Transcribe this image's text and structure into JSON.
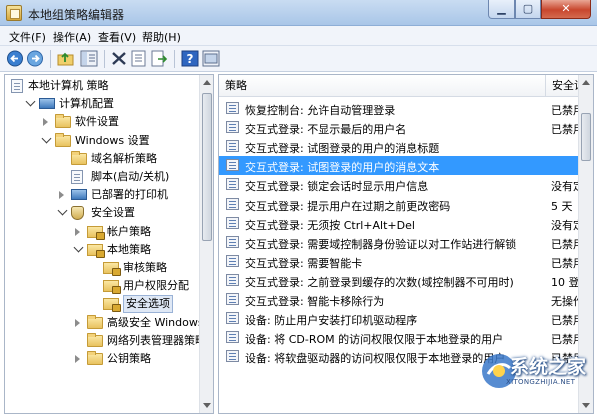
{
  "window": {
    "title": "本地组策略编辑器"
  },
  "menu": [
    "文件(F)",
    "操作(A)",
    "查看(V)",
    "帮助(H)"
  ],
  "toolbar": [
    "back-icon",
    "forward-icon",
    "up-folder-icon",
    "show-hide-tree-icon",
    "delete-icon",
    "properties-icon",
    "export-icon",
    "help-icon",
    "view-icon"
  ],
  "tree": [
    {
      "label": "本地计算机 策略",
      "depth": 0,
      "expander": "none",
      "icon": "doc"
    },
    {
      "label": "计算机配置",
      "depth": 1,
      "expander": "open",
      "icon": "comp"
    },
    {
      "label": "软件设置",
      "depth": 2,
      "expander": "closed",
      "icon": "folder"
    },
    {
      "label": "Windows 设置",
      "depth": 2,
      "expander": "open",
      "icon": "folder"
    },
    {
      "label": "域名解析策略",
      "depth": 3,
      "expander": "none",
      "icon": "folder"
    },
    {
      "label": "脚本(启动/关机)",
      "depth": 3,
      "expander": "none",
      "icon": "doc"
    },
    {
      "label": "已部署的打印机",
      "depth": 3,
      "expander": "closed",
      "icon": "comp"
    },
    {
      "label": "安全设置",
      "depth": 3,
      "expander": "open",
      "icon": "shield"
    },
    {
      "label": "帐户策略",
      "depth": 4,
      "expander": "closed",
      "icon": "lockf"
    },
    {
      "label": "本地策略",
      "depth": 4,
      "expander": "open",
      "icon": "lockf"
    },
    {
      "label": "审核策略",
      "depth": 5,
      "expander": "none",
      "icon": "lockf"
    },
    {
      "label": "用户权限分配",
      "depth": 5,
      "expander": "none",
      "icon": "lockf"
    },
    {
      "label": "安全选项",
      "depth": 5,
      "expander": "none",
      "icon": "lockf",
      "selected": true
    },
    {
      "label": "高级安全 Windows",
      "depth": 4,
      "expander": "closed",
      "icon": "folder"
    },
    {
      "label": "网络列表管理器策略",
      "depth": 4,
      "expander": "none",
      "icon": "folder"
    },
    {
      "label": "公钥策略",
      "depth": 4,
      "expander": "closed",
      "icon": "folder"
    }
  ],
  "list": {
    "headers": [
      "策略",
      "安全设"
    ],
    "rows": [
      {
        "policy": "恢复控制台: 允许自动管理登录",
        "setting": "已禁用"
      },
      {
        "policy": "交互式登录: 不显示最后的用户名",
        "setting": "已禁用"
      },
      {
        "policy": "交互式登录: 试图登录的用户的消息标题",
        "setting": ""
      },
      {
        "policy": "交互式登录: 试图登录的用户的消息文本",
        "setting": "",
        "selected": true
      },
      {
        "policy": "交互式登录: 锁定会话时显示用户信息",
        "setting": "没有定"
      },
      {
        "policy": "交互式登录: 提示用户在过期之前更改密码",
        "setting": "5 天"
      },
      {
        "policy": "交互式登录: 无须按 Ctrl+Alt+Del",
        "setting": "没有定"
      },
      {
        "policy": "交互式登录: 需要域控制器身份验证以对工作站进行解锁",
        "setting": "已禁用"
      },
      {
        "policy": "交互式登录: 需要智能卡",
        "setting": "已禁用"
      },
      {
        "policy": "交互式登录: 之前登录到缓存的次数(域控制器不可用时)",
        "setting": "10 登"
      },
      {
        "policy": "交互式登录: 智能卡移除行为",
        "setting": "无操作"
      },
      {
        "policy": "设备: 防止用户安装打印机驱动程序",
        "setting": "已禁用"
      },
      {
        "policy": "设备: 将 CD-ROM 的访问权限仅限于本地登录的用户",
        "setting": "已禁用"
      },
      {
        "policy": "设备: 将软盘驱动器的访问权限仅限于本地登录的用户",
        "setting": "已禁用"
      }
    ]
  },
  "watermark": {
    "name": "系统之家",
    "url": "XITONGZHIJIA.NET"
  }
}
